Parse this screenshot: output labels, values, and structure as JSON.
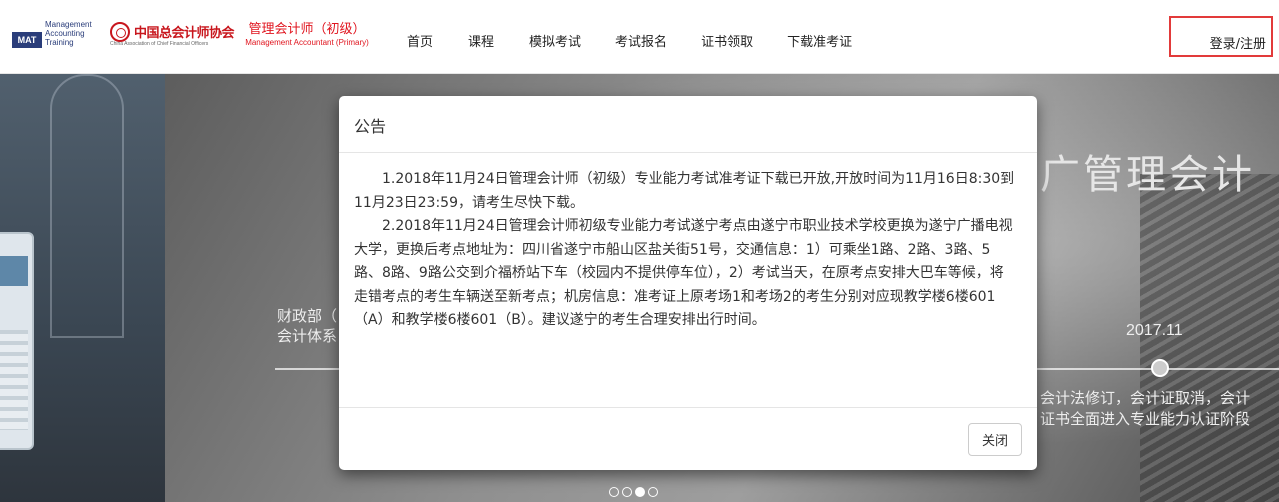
{
  "header": {
    "mat_logo": {
      "box": "MAT",
      "lines": [
        "Management",
        "Accounting",
        "Training"
      ]
    },
    "cacfo_logo": {
      "cn": "中国总会计师协会",
      "en": "China Association of Chief Financial Officers"
    },
    "brand": {
      "cn": "管理会计师（初级）",
      "en": "Management Accountant (Primary)"
    },
    "nav": [
      "首页",
      "课程",
      "模拟考试",
      "考试报名",
      "证书领取",
      "下载准考证"
    ],
    "login": "登录/注册"
  },
  "banner": {
    "title": "广管理会计",
    "year": "2017.11",
    "left_event": [
      "财政部（",
      "会计体系"
    ],
    "right_event": [
      "会计法修订，会计证取消，会计",
      "证书全面进入专业能力认证阶段"
    ],
    "carousel_active_index": 2
  },
  "modal": {
    "title": "公告",
    "paragraphs": [
      "1.2018年11月24日管理会计师（初级）专业能力考试准考证下载已开放,开放时间为11月16日8:30到11月23日23:59，请考生尽快下载。",
      "2.2018年11月24日管理会计师初级专业能力考试遂宁考点由遂宁市职业技术学校更换为遂宁广播电视大学，更换后考点地址为：四川省遂宁市船山区盐关街51号，交通信息：1）可乘坐1路、2路、3路、5路、8路、9路公交到介福桥站下车（校园内不提供停车位），2）考试当天，在原考点安排大巴车等候，将走错考点的考生车辆送至新考点；机房信息：准考证上原考场1和考场2的考生分别对应现教学楼6楼601（A）和教学楼6楼601（B）。建议遂宁的考生合理安排出行时间。"
    ],
    "close_label": "关闭"
  },
  "colors": {
    "brand_red": "#e0141e",
    "login_highlight": "#e23a3a",
    "mat_blue": "#2a3d7a"
  }
}
